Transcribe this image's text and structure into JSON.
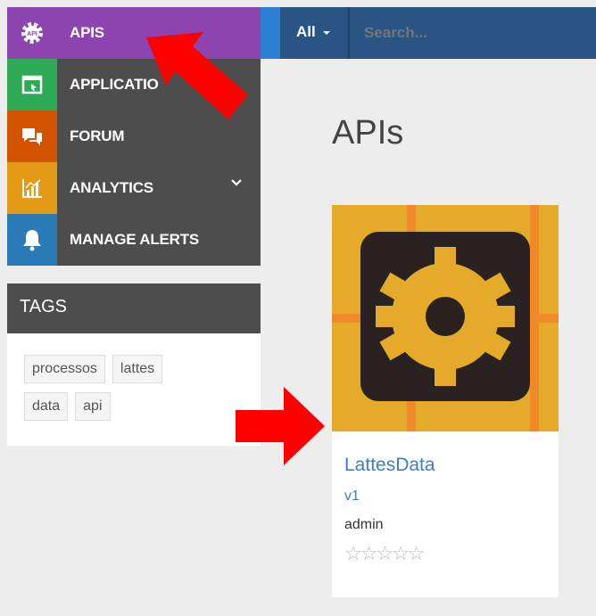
{
  "nav": {
    "items": [
      {
        "label": "APIS",
        "icon": "api-gear-icon",
        "color": "#8d44b0"
      },
      {
        "label": "APPLICATIO",
        "icon": "application-window-icon",
        "color": "#2eaa56"
      },
      {
        "label": "FORUM",
        "icon": "chat-bubbles-icon",
        "color": "#d35400"
      },
      {
        "label": "ANALYTICS",
        "icon": "bar-chart-icon",
        "color": "#e39b17"
      },
      {
        "label": "MANAGE ALERTS",
        "icon": "bell-icon",
        "color": "#2a7ab8"
      }
    ]
  },
  "topbar": {
    "filter_label": "All",
    "search_placeholder": "Search..."
  },
  "tags": {
    "heading": "TAGS",
    "items": [
      "processos",
      "lattes",
      "data",
      "api"
    ]
  },
  "main": {
    "title": "APIs"
  },
  "card": {
    "name": "LattesData",
    "version": "v1",
    "owner": "admin",
    "stars": "☆☆☆☆☆",
    "rating": 0
  },
  "annotations": {
    "arrow_color": "#ff0000"
  }
}
